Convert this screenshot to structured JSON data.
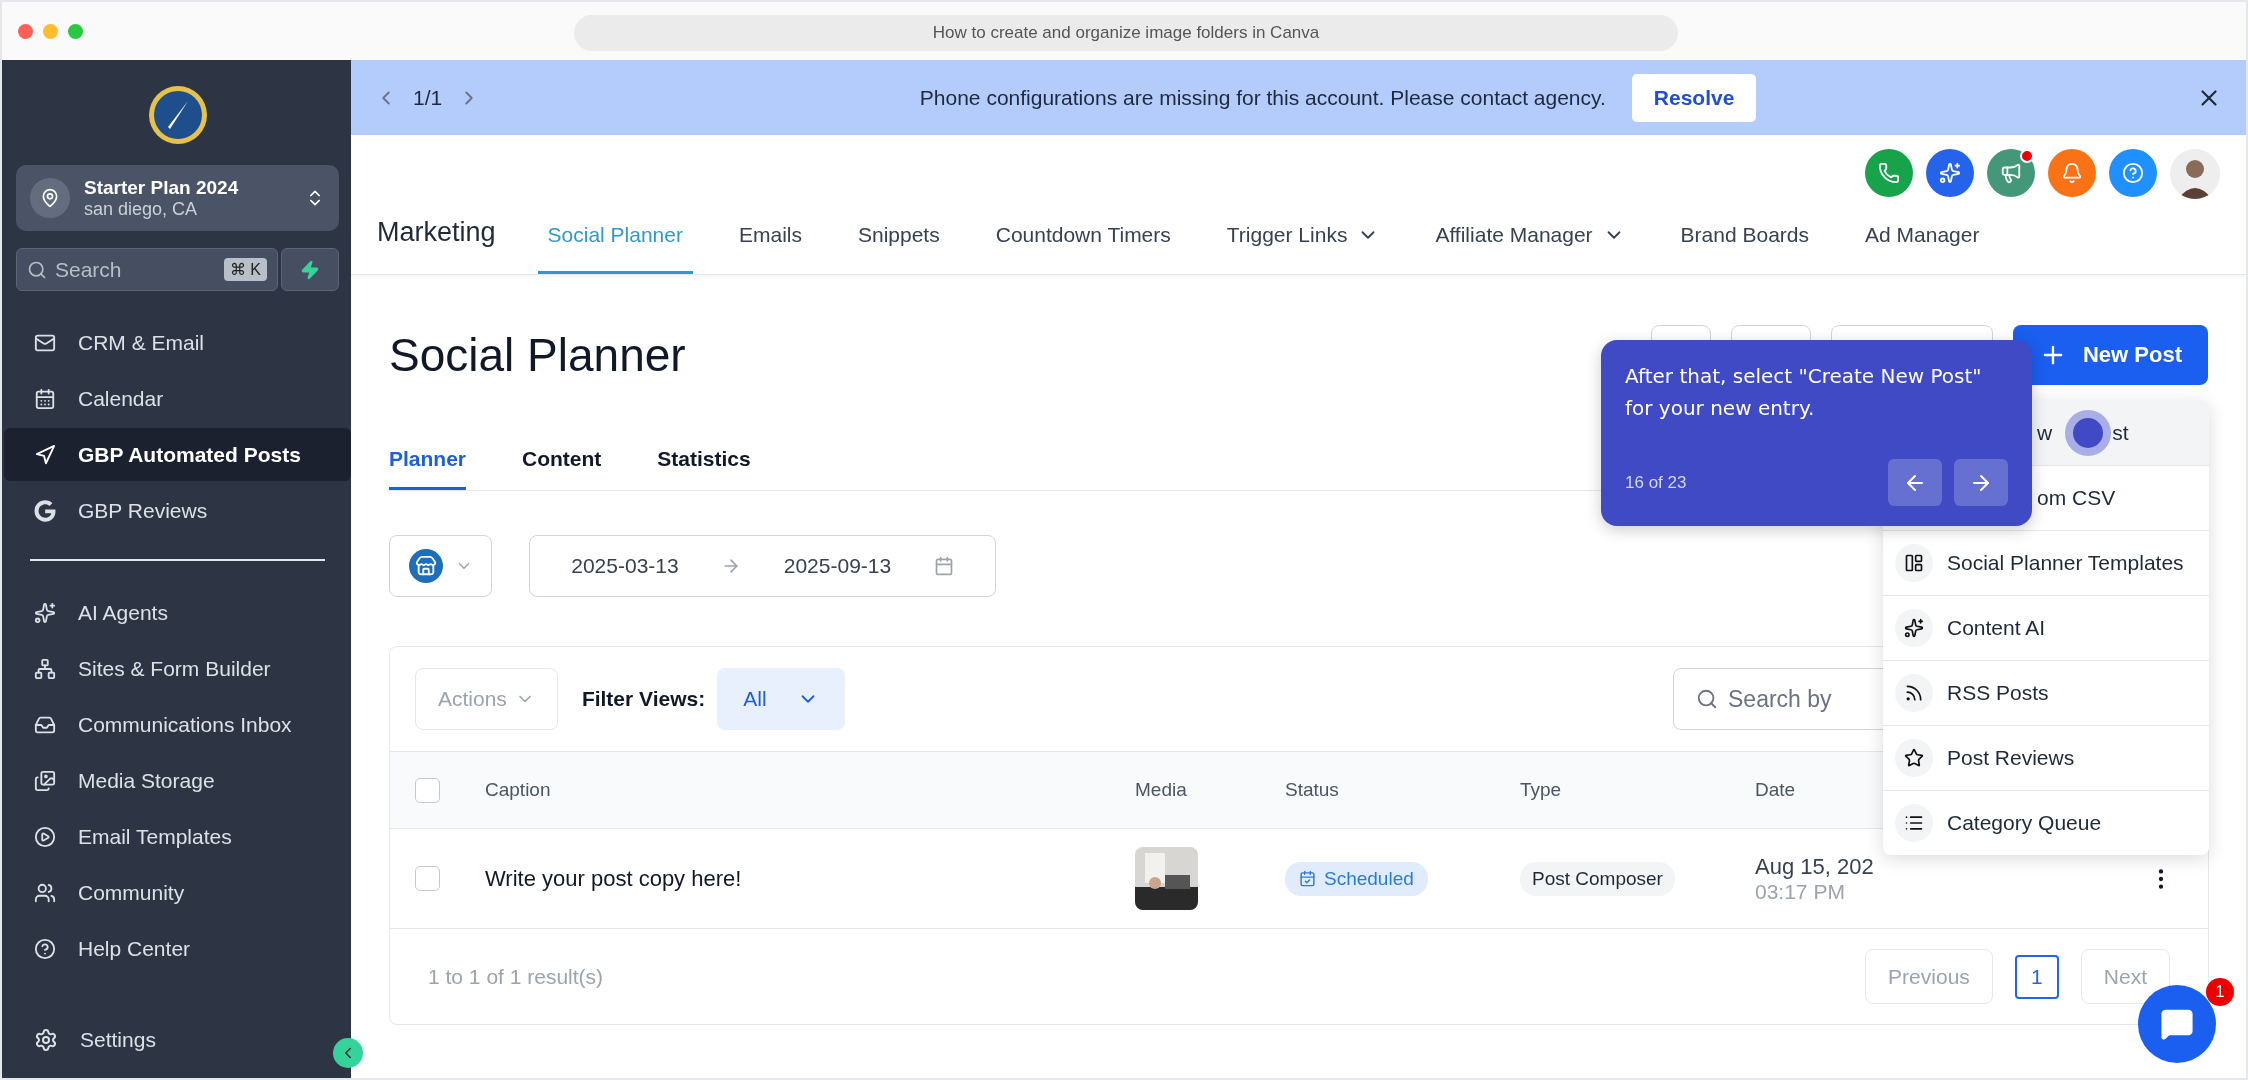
{
  "browser": {
    "address": "How to create and organize image folders in Canva"
  },
  "sidebar": {
    "account": {
      "name": "Starter Plan 2024",
      "location": "san diego, CA"
    },
    "search": {
      "placeholder": "Search",
      "shortcut": "⌘ K"
    },
    "items": [
      {
        "label": "CRM & Email",
        "kind": "mail",
        "selected": false
      },
      {
        "label": "Calendar",
        "kind": "calendar",
        "selected": false
      },
      {
        "label": "GBP Automated Posts",
        "kind": "send",
        "selected": true
      },
      {
        "label": "GBP Reviews",
        "kind": "google",
        "selected": false
      }
    ],
    "more_items": [
      {
        "label": "AI Agents",
        "kind": "sparkles",
        "selected": false
      },
      {
        "label": "Sites & Form Builder",
        "kind": "sitemap",
        "selected": false
      },
      {
        "label": "Communications Inbox",
        "kind": "inbox",
        "selected": false
      },
      {
        "label": "Media Storage",
        "kind": "images",
        "selected": false
      },
      {
        "label": "Email Templates",
        "kind": "play",
        "selected": false
      },
      {
        "label": "Community",
        "kind": "users",
        "selected": false
      },
      {
        "label": "Help Center",
        "kind": "help",
        "selected": false
      }
    ],
    "settings": {
      "label": "Settings"
    }
  },
  "banner": {
    "counter": "1/1",
    "message": "Phone configurations are missing for this account. Please contact agency.",
    "action": "Resolve"
  },
  "header_icons": [
    {
      "kind": "phone",
      "color": "#16a34a",
      "dot": false
    },
    {
      "kind": "sparkle",
      "color": "#2563eb",
      "dot": false
    },
    {
      "kind": "megaphone",
      "color": "#45977a",
      "dot": true
    },
    {
      "kind": "bell",
      "color": "#f97316",
      "dot": false
    },
    {
      "kind": "help",
      "color": "#1e90ff",
      "dot": false
    }
  ],
  "nav": {
    "title": "Marketing",
    "tabs": [
      {
        "label": "Social Planner",
        "selected": true,
        "has_menu": false
      },
      {
        "label": "Emails",
        "selected": false,
        "has_menu": false
      },
      {
        "label": "Snippets",
        "selected": false,
        "has_menu": false
      },
      {
        "label": "Countdown Timers",
        "selected": false,
        "has_menu": false
      },
      {
        "label": "Trigger Links",
        "selected": false,
        "has_menu": true
      },
      {
        "label": "Affiliate Manager",
        "selected": false,
        "has_menu": true
      },
      {
        "label": "Brand Boards",
        "selected": false,
        "has_menu": false
      },
      {
        "label": "Ad Manager",
        "selected": false,
        "has_menu": false
      }
    ]
  },
  "page": {
    "title": "Social Planner",
    "new_post": "New Post",
    "tabs": [
      {
        "label": "Planner",
        "selected": true
      },
      {
        "label": "Content",
        "selected": false
      },
      {
        "label": "Statistics",
        "selected": false
      }
    ],
    "date_range": {
      "start": "2025-03-13",
      "end": "2025-09-13"
    }
  },
  "table": {
    "actions": "Actions",
    "filter_label": "Filter Views:",
    "filter_value": "All",
    "search_placeholder": "Search by",
    "select_all_checked": false,
    "columns": [
      "Caption",
      "Media",
      "Status",
      "Type",
      "Date"
    ],
    "rows": [
      {
        "checked": false,
        "caption": "Write your post copy here!",
        "status": "Scheduled",
        "type": "Post Composer",
        "date": "Aug 15, 202",
        "time": "03:17 PM"
      }
    ],
    "summary": "1 to 1 of 1 result(s)",
    "pagination": {
      "previous": "Previous",
      "pages": [
        {
          "label": "1",
          "selected": true
        }
      ],
      "next": "Next"
    }
  },
  "dropdown": {
    "items": [
      {
        "label": "w",
        "label_end": "st",
        "kind": "none",
        "highlighted": true
      },
      {
        "label": "om CSV",
        "kind": "none",
        "highlighted": false
      },
      {
        "label": "Social Planner Templates",
        "kind": "template",
        "highlighted": false
      },
      {
        "label": "Content AI",
        "kind": "sparkles",
        "highlighted": false
      },
      {
        "label": "RSS Posts",
        "kind": "rss",
        "highlighted": false
      },
      {
        "label": "Post Reviews",
        "kind": "star",
        "highlighted": false
      },
      {
        "label": "Category Queue",
        "kind": "list",
        "highlighted": false
      }
    ]
  },
  "tour": {
    "text": "After that, select \"Create New Post\" for your new entry.",
    "step": "16 of 23"
  },
  "chat": {
    "badge": "1"
  }
}
